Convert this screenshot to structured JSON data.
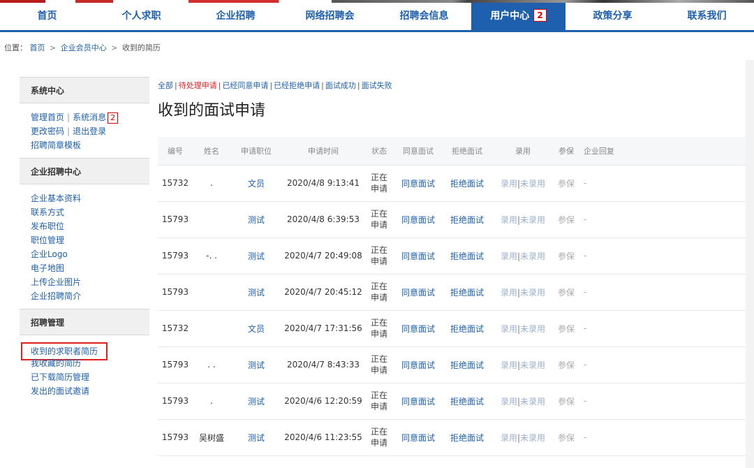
{
  "nav": {
    "items": [
      {
        "label": "首页",
        "active": false
      },
      {
        "label": "个人求职",
        "active": false
      },
      {
        "label": "企业招聘",
        "active": false
      },
      {
        "label": "网络招聘会",
        "active": false
      },
      {
        "label": "招聘会信息",
        "active": false
      },
      {
        "label": "用户中心",
        "active": true,
        "badge": "2"
      },
      {
        "label": "政策分享",
        "active": false
      },
      {
        "label": "联系我们",
        "active": false
      }
    ]
  },
  "breadcrumb": {
    "prefix": "位置：",
    "home": "首页",
    "sep": ">",
    "parent": "企业会员中心",
    "current": "收到的简历"
  },
  "sidebar": {
    "sections": [
      {
        "title": "系统中心",
        "rows": [
          {
            "links": [
              "管理首页",
              "系统消息"
            ],
            "badge": "2"
          },
          {
            "links": [
              "更改密码",
              "退出登录"
            ]
          },
          {
            "links": [
              "招聘简章模板"
            ]
          }
        ]
      },
      {
        "title": "企业招聘中心",
        "rows": [
          {
            "links": [
              "企业基本资料"
            ]
          },
          {
            "links": [
              "联系方式"
            ]
          },
          {
            "links": [
              "发布职位"
            ]
          },
          {
            "links": [
              "职位管理"
            ]
          },
          {
            "links": [
              "企业Logo"
            ]
          },
          {
            "links": [
              "电子地图"
            ]
          },
          {
            "links": [
              "上传企业图片"
            ]
          },
          {
            "links": [
              "企业招聘简介"
            ]
          }
        ]
      },
      {
        "title": "招聘管理",
        "rows": [
          {
            "links": [
              "收到的求职者简历"
            ],
            "highlighted": true
          },
          {
            "links": [
              "我收藏的简历"
            ]
          },
          {
            "links": [
              "已下载简历管理"
            ]
          },
          {
            "links": [
              "发出的面试邀请"
            ]
          }
        ]
      }
    ]
  },
  "filters": [
    {
      "label": "全部",
      "current": false
    },
    {
      "label": "待处理申请",
      "current": true
    },
    {
      "label": "已经同意申请",
      "current": false
    },
    {
      "label": "已经拒绝申请",
      "current": false
    },
    {
      "label": "面试成功",
      "current": false
    },
    {
      "label": "面试失败",
      "current": false
    }
  ],
  "filter_sep": "|",
  "title": "收到的面试申请",
  "table": {
    "columns": [
      "编号",
      "姓名",
      "申请职位",
      "申请时间",
      "状态",
      "同意面试",
      "拒绝面试",
      "录用",
      "参保",
      "企业回复"
    ],
    "rows": [
      {
        "id": "15732",
        "name": ".",
        "position": "文员",
        "time": "2020/4/8 9:13:41",
        "status": "正在申请",
        "agree": "同意面试",
        "reject": "拒绝面试",
        "hire": "录用",
        "nohire": "未录用",
        "insure": "参保",
        "reply": "-"
      },
      {
        "id": "15793",
        "name": "",
        "position": "测试",
        "time": "2020/4/8 6:39:53",
        "status": "正在申请",
        "agree": "同意面试",
        "reject": "拒绝面试",
        "hire": "录用",
        "nohire": "未录用",
        "insure": "参保",
        "reply": "-"
      },
      {
        "id": "15793",
        "name": "-. .",
        "position": "测试",
        "time": "2020/4/7 20:49:08",
        "status": "正在申请",
        "agree": "同意面试",
        "reject": "拒绝面试",
        "hire": "录用",
        "nohire": "未录用",
        "insure": "参保",
        "reply": "-"
      },
      {
        "id": "15793",
        "name": "",
        "position": "测试",
        "time": "2020/4/7 20:45:12",
        "status": "正在申请",
        "agree": "同意面试",
        "reject": "拒绝面试",
        "hire": "录用",
        "nohire": "未录用",
        "insure": "参保",
        "reply": "-"
      },
      {
        "id": "15732",
        "name": "",
        "position": "文员",
        "time": "2020/4/7 17:31:56",
        "status": "正在申请",
        "agree": "同意面试",
        "reject": "拒绝面试",
        "hire": "录用",
        "nohire": "未录用",
        "insure": "参保",
        "reply": "-"
      },
      {
        "id": "15793",
        "name": ".   .",
        "position": "测试",
        "time": "2020/4/7 8:43:33",
        "status": "正在申请",
        "agree": "同意面试",
        "reject": "拒绝面试",
        "hire": "录用",
        "nohire": "未录用",
        "insure": "参保",
        "reply": "-"
      },
      {
        "id": "15793",
        "name": ".",
        "position": "测试",
        "time": "2020/4/6 12:20:59",
        "status": "正在申请",
        "agree": "同意面试",
        "reject": "拒绝面试",
        "hire": "录用",
        "nohire": "未录用",
        "insure": "参保",
        "reply": "-"
      },
      {
        "id": "15793",
        "name": "吴树盛",
        "position": "测试",
        "time": "2020/4/6 11:23:55",
        "status": "正在申请",
        "agree": "同意面试",
        "reject": "拒绝面试",
        "hire": "录用",
        "nohire": "未录用",
        "insure": "参保",
        "reply": "-"
      }
    ]
  },
  "colors": {
    "brand_blue": "#1e5fae",
    "highlight_red": "#e01f1f"
  }
}
